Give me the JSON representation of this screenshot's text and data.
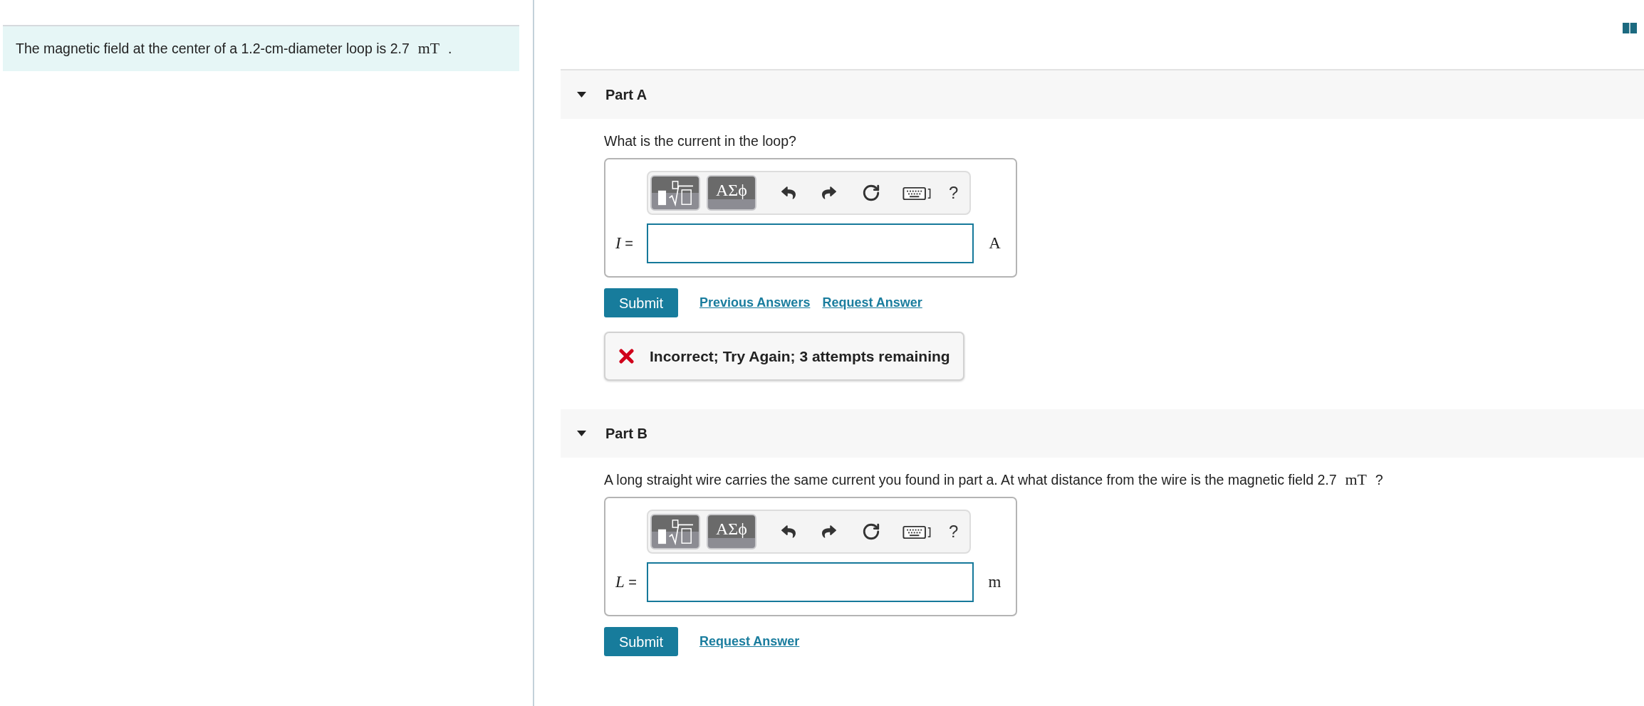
{
  "problem": {
    "segments": [
      {
        "kind": "text",
        "text": "The magnetic field at the center of a 1.2-cm-diameter loop is 2.7"
      },
      {
        "kind": "math",
        "text": "mT"
      },
      {
        "kind": "text",
        "text": "."
      }
    ]
  },
  "parts": [
    {
      "title": "Part A",
      "expanded": true,
      "question": {
        "segments": [
          {
            "kind": "text",
            "text": "What is the current in the loop?"
          }
        ]
      },
      "toolbar": {
        "greek": "ΑΣϕ",
        "help": "?"
      },
      "answer": {
        "variable": "I",
        "relation": "=",
        "unit": "A"
      },
      "submit": "Submit",
      "links": [
        "Previous Answers",
        "Request Answer"
      ],
      "feedback": {
        "kind": "incorrect",
        "text": "Incorrect; Try Again; 3 attempts remaining"
      }
    },
    {
      "title": "Part B",
      "expanded": true,
      "question": {
        "segments": [
          {
            "kind": "text",
            "text": "A long straight wire carries the same current you found in part a. At what distance from the wire is the magnetic field 2.7"
          },
          {
            "kind": "math",
            "text": "mT"
          },
          {
            "kind": "text",
            "text": "?"
          }
        ]
      },
      "toolbar": {
        "greek": "ΑΣϕ",
        "help": "?"
      },
      "answer": {
        "variable": "L",
        "relation": "=",
        "unit": "m"
      },
      "submit": "Submit",
      "links": [
        "Request Answer"
      ]
    }
  ]
}
